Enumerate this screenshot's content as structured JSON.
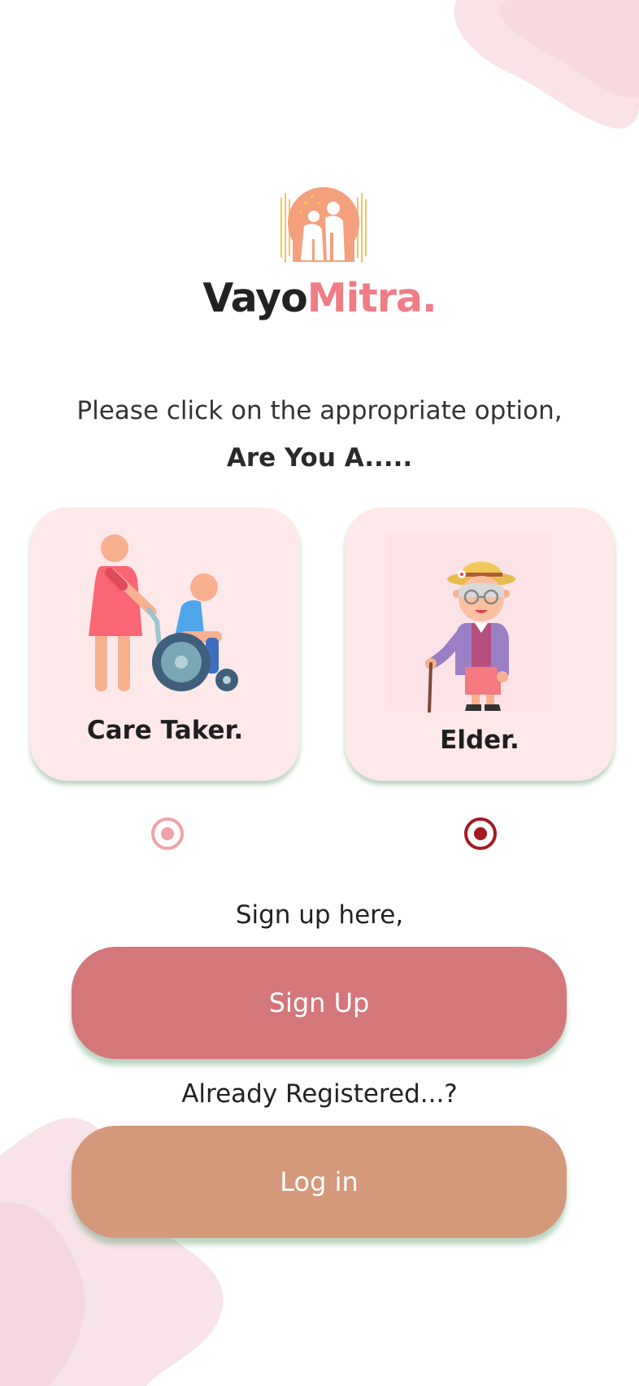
{
  "brand": {
    "name_part1": "Vayo",
    "name_part2": "Mitra."
  },
  "colors": {
    "brand_primary": "#f07c86",
    "signup_button": "#d4777a",
    "login_button": "#d4987a",
    "card_background": "#fde8ea",
    "radio_selected": "#a31a22",
    "radio_unselected": "#f2a1a8"
  },
  "prompt": "Please click on the appropriate option,",
  "question": "Are You A.....",
  "roles": [
    {
      "label": "Care Taker.",
      "icon": "caretaker-illustration",
      "selected": false
    },
    {
      "label": "Elder.",
      "icon": "elder-illustration",
      "selected": true
    }
  ],
  "signup": {
    "hint": "Sign up here,",
    "button_label": "Sign Up"
  },
  "login": {
    "hint": "Already Registered...?",
    "button_label": "Log in"
  }
}
